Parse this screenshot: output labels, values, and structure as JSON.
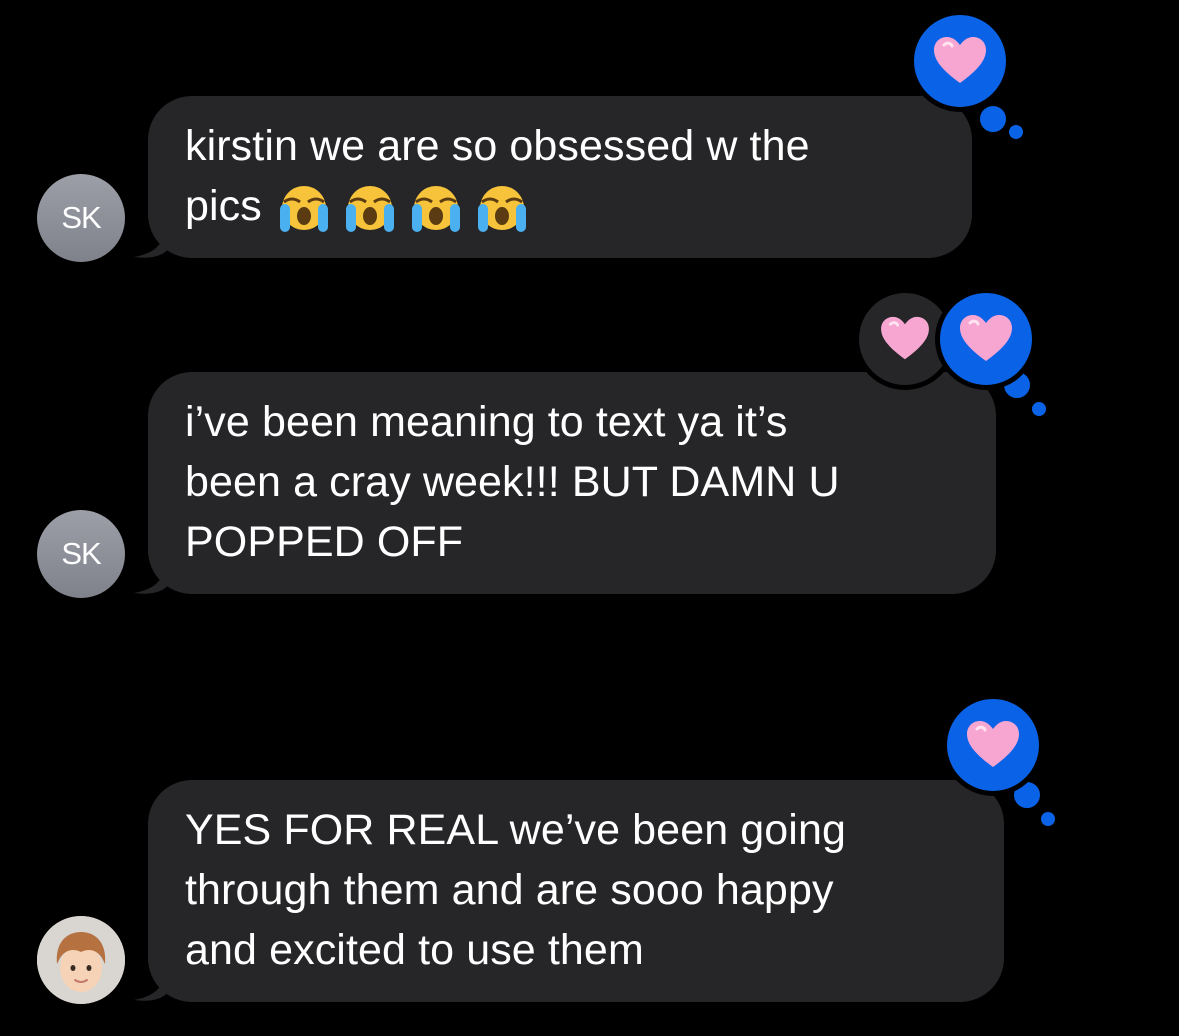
{
  "messages": [
    {
      "avatar_initials": "SK",
      "lines": [
        "kirstin we are so obsessed w the",
        "pics"
      ],
      "emoji": [
        "loudly-crying-face",
        "loudly-crying-face",
        "loudly-crying-face",
        "loudly-crying-face"
      ],
      "reactions": [
        "pink-heart"
      ]
    },
    {
      "avatar_initials": "SK",
      "text": "i’ve been meaning to text ya it’s\nbeen a cray week!!! BUT DAMN U\nPOPPED OFF",
      "reactions": [
        "pink-heart",
        "pink-heart"
      ]
    },
    {
      "avatar": "memoji-avatar",
      "text": "YES FOR REAL we’ve been going\nthrough them and are sooo happy\nand excited to use them",
      "reactions": [
        "pink-heart"
      ]
    }
  ],
  "colors": {
    "background": "#000000",
    "bubble": "#262628",
    "tapback_blue": "#0a62e6",
    "heart_pink": "#f7a6d2"
  }
}
